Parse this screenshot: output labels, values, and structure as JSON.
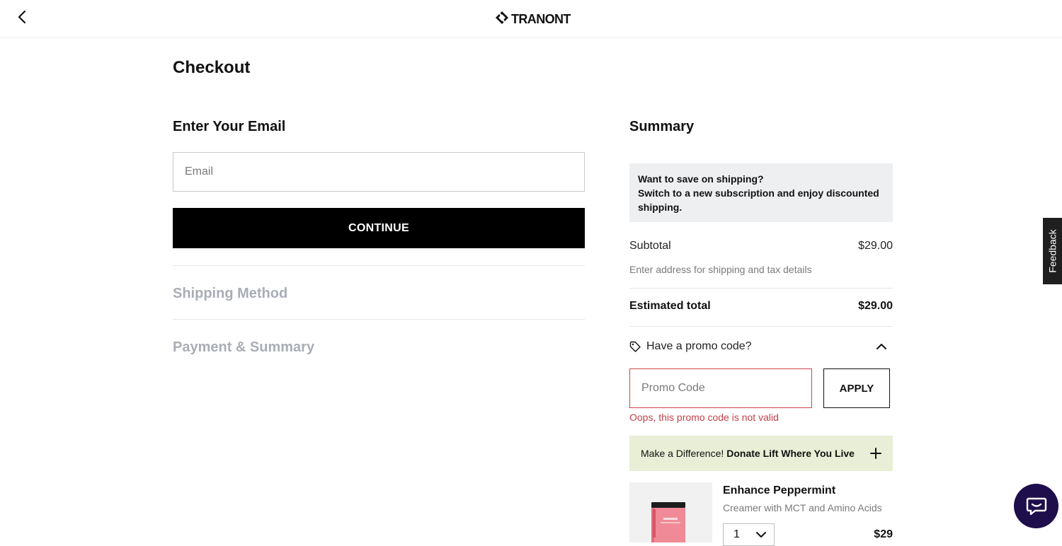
{
  "header": {
    "logo_text": "TRANONT"
  },
  "checkout": {
    "title": "Checkout",
    "email_section_title": "Enter Your Email",
    "email_placeholder": "Email",
    "continue_label": "CONTINUE",
    "steps": [
      {
        "label": "Shipping Method"
      },
      {
        "label": "Payment & Summary"
      }
    ]
  },
  "summary": {
    "title": "Summary",
    "shipping_banner": {
      "line1": "Want to save on shipping?",
      "line2": "Switch to a new subscription and enjoy discounted shipping."
    },
    "subtotal_label": "Subtotal",
    "subtotal_value": "$29.00",
    "address_note": "Enter address for shipping and tax details",
    "estimated_total_label": "Estimated total",
    "estimated_total_value": "$29.00",
    "promo": {
      "toggle_label": "Have a promo code?",
      "placeholder": "Promo Code",
      "apply_label": "APPLY",
      "error": "Oops, this promo code is not valid"
    },
    "donate": {
      "prefix": "Make a Difference!",
      "bold": "Donate Lift Where You Live"
    },
    "product": {
      "name": "Enhance Peppermint",
      "description": "Creamer with MCT and Amino Acids",
      "quantity": "1",
      "price": "$29"
    }
  },
  "feedback_label": "Feedback",
  "colors": {
    "accent": "#000000",
    "error": "#c4414b",
    "banner_bg": "#eeeff1",
    "donate_bg": "#e8efd6",
    "chat_bg": "#1e0e4b",
    "muted_step": "#a9adb5"
  },
  "icons": {
    "back": "chevron-left-icon",
    "promo": "tag-icon",
    "promo_toggle": "chevron-up-icon",
    "donate": "plus-icon",
    "qty": "chevron-down-icon",
    "chat": "chat-bubble-icon"
  }
}
